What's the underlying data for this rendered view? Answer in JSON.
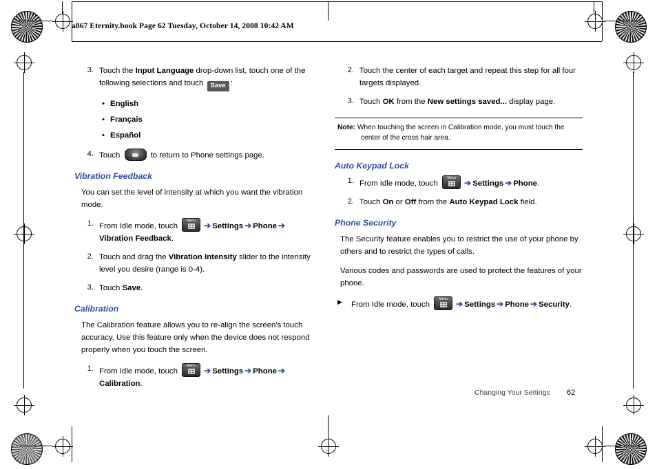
{
  "header": {
    "file_line": "a867 Eternity.book  Page 62  Tuesday, October 14, 2008  10:42 AM"
  },
  "left_column": {
    "step3": {
      "num": "3.",
      "t1": "Touch the ",
      "b1": "Input Language",
      "t2": " drop-down list, touch one of the following selections and touch ",
      "save_key": "Save",
      "t3": ":"
    },
    "bullets": [
      "English",
      "Français",
      "Español"
    ],
    "step4": {
      "num": "4.",
      "t1": "Touch ",
      "t2": " to return to Phone settings page."
    },
    "vibration": {
      "heading": "Vibration Feedback",
      "para": "You can set the level of intensity at which you want the vibration mode.",
      "step1": {
        "num": "1.",
        "t1": "From Idle mode, touch ",
        "nav1": "Settings",
        "nav2": "Phone",
        "nav3": "Vibration Feedback",
        "end": "."
      },
      "step2": {
        "num": "2.",
        "t1": "Touch and drag the ",
        "b1": "Vibration Intensity",
        "t2": " slider to the intensity level you desire (range is 0-4)."
      },
      "step3": {
        "num": "3.",
        "t1": "Touch ",
        "b1": "Save",
        "t2": "."
      }
    },
    "calibration": {
      "heading": "Calibration",
      "para": "The Calibration feature allows you to re-align the screen's touch accuracy. Use this feature only when the device does not respond properly when you touch the screen.",
      "step1": {
        "num": "1.",
        "t1": "From Idle mode, touch ",
        "nav1": "Settings",
        "nav2": "Phone",
        "nav3": "Calibration",
        "end": "."
      }
    }
  },
  "right_column": {
    "step2": {
      "num": "2.",
      "text": "Touch the center of each target and repeat this step for all four targets displayed."
    },
    "step3": {
      "num": "3.",
      "t1": "Touch ",
      "b1": "OK",
      "t2": " from the ",
      "b2": "New settings saved...",
      "t3": " display page."
    },
    "note": {
      "label": "Note:",
      "line1": "When touching the screen in Calibration mode, you must touch the",
      "line2": "center of the cross hair area."
    },
    "auto_keypad_lock": {
      "heading": "Auto Keypad Lock",
      "step1": {
        "num": "1.",
        "t1": "From Idle mode, touch ",
        "nav1": "Settings",
        "nav2": "Phone",
        "end": "."
      },
      "step2": {
        "num": "2.",
        "t1": "Touch ",
        "b1": "On",
        "t2": " or ",
        "b2": "Off",
        "t3": " from the ",
        "b3": "Auto Keypad Lock",
        "t4": " field."
      }
    },
    "phone_security": {
      "heading": "Phone Security",
      "para1": "The Security feature enables you to restrict the use of your phone by others and to restrict the types of calls.",
      "para2": "Various codes and passwords are used to protect the features of your phone.",
      "tri_step": {
        "t1": "From Idle mode, touch ",
        "nav1": "Settings",
        "nav2": "Phone",
        "nav3": "Security",
        "end": "."
      }
    }
  },
  "footer": {
    "text": "Changing Your Settings",
    "page": "62"
  },
  "icons": {
    "menu_key_label": "Menu",
    "arrow_glyph": "➔",
    "bullet_glyph": "•",
    "triangle_glyph": "▶"
  },
  "colors": {
    "heading_blue": "#2f4f9e",
    "key_dark": "#2b2b2b",
    "save_key_bg": "#5a5a5a"
  }
}
